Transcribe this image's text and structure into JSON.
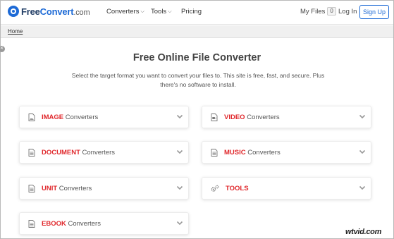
{
  "header": {
    "logo": {
      "part1": "Free",
      "part2": "Convert",
      "tld": ".com"
    },
    "nav": [
      {
        "label": "Converters",
        "has_dropdown": true
      },
      {
        "label": "Tools",
        "has_dropdown": true
      },
      {
        "label": "Pricing",
        "has_dropdown": false
      }
    ],
    "my_files_label": "My Files",
    "my_files_count": "0",
    "login_label": "Log In",
    "signup_label": "Sign Up"
  },
  "breadcrumb": {
    "home": "Home"
  },
  "main": {
    "title": "Free Online File Converter",
    "subtitle": "Select the target format you want to convert your files to. This site is free, fast, and secure. Plus there's no software to install."
  },
  "cards": {
    "image": {
      "highlight": "IMAGE",
      "rest": " Converters",
      "icon": "image-file-icon"
    },
    "video": {
      "highlight": "VIDEO",
      "rest": " Converters",
      "icon": "video-file-icon"
    },
    "document": {
      "highlight": "DOCUMENT",
      "rest": " Converters",
      "icon": "document-file-icon"
    },
    "music": {
      "highlight": "MUSIC",
      "rest": " Converters",
      "icon": "music-file-icon"
    },
    "unit": {
      "highlight": "UNIT",
      "rest": " Converters",
      "icon": "unit-file-icon"
    },
    "tools": {
      "highlight": "TOOLS",
      "rest": "",
      "icon": "gears-icon"
    },
    "ebook": {
      "highlight": "EBOOK",
      "rest": " Converters",
      "icon": "ebook-file-icon"
    }
  },
  "watermark": "wtvid.com",
  "colors": {
    "brand_blue": "#1d6ad6",
    "highlight_red": "#e0282c"
  }
}
